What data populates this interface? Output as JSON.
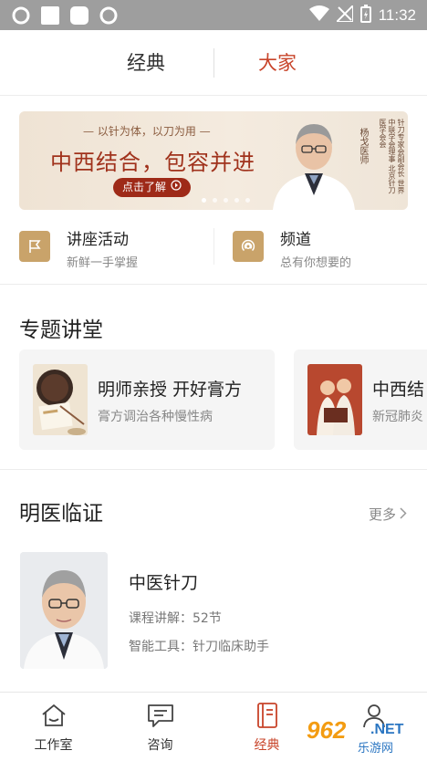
{
  "status_bar": {
    "time": "11:32"
  },
  "top_nav": {
    "tabs": [
      {
        "label": "经典"
      },
      {
        "label": "大家"
      }
    ]
  },
  "banner": {
    "slogan": "— 以针为体，以刀为用 —",
    "headline": "中西结合，包容并进",
    "button_label": "点击了解",
    "doctor_name": "杨戈医师",
    "doctor_title": "针刀专家会副会长 世界中联学会理事 北京针刀医学会会",
    "pager": {
      "total": 5,
      "active": 0
    }
  },
  "quick_links": [
    {
      "title": "讲座活动",
      "subtitle": "新鲜一手掌握",
      "icon": "flag-icon"
    },
    {
      "title": "频道",
      "subtitle": "总有你想要的",
      "icon": "broadcast-icon"
    }
  ],
  "special_lectures": {
    "title": "专题讲堂",
    "cards": [
      {
        "title": "明师亲授 开好膏方",
        "subtitle": "膏方调治各种慢性病"
      },
      {
        "title": "中西结",
        "subtitle": "新冠肺炎"
      }
    ]
  },
  "famous_doctors": {
    "title": "明医临证",
    "more_label": "更多",
    "items": [
      {
        "title": "中医针刀",
        "lessons": "课程讲解：52节",
        "tool": "智能工具：针刀临床助手"
      }
    ]
  },
  "tab_bar": {
    "items": [
      {
        "label": "工作室",
        "icon": "home-icon"
      },
      {
        "label": "咨询",
        "icon": "chat-icon"
      },
      {
        "label": "经典",
        "icon": "book-icon",
        "active": true
      },
      {
        "label": "",
        "icon": "user-icon"
      }
    ]
  },
  "watermark": {
    "brand": "962",
    "suffix": ".NET",
    "cn": "乐游网"
  },
  "colors": {
    "accent": "#c8442a",
    "gold": "#c9a36a",
    "banner_red": "#a0321c"
  }
}
